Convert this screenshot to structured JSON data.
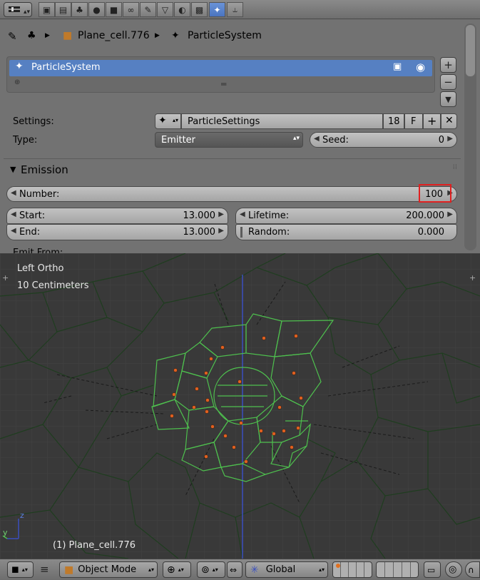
{
  "header": {
    "tabs": [
      "render",
      "render-layers",
      "scene",
      "world",
      "object",
      "constraints",
      "modifiers",
      "data",
      "material",
      "texture",
      "particles",
      "physics"
    ],
    "active": "particles"
  },
  "path": {
    "object": "Plane_cell.776",
    "item": "ParticleSystem"
  },
  "slots": {
    "selected": "ParticleSystem"
  },
  "settings": {
    "label": "Settings:",
    "name": "ParticleSettings",
    "users": "18",
    "fake": "F"
  },
  "type": {
    "label": "Type:",
    "value": "Emitter"
  },
  "seed": {
    "label": "Seed:",
    "value": "0"
  },
  "emission": {
    "title": "Emission",
    "number_label": "Number:",
    "number_value": "100",
    "start_label": "Start:",
    "start_value": "13.000",
    "end_label": "End:",
    "end_value": "13.000",
    "lifetime_label": "Lifetime:",
    "lifetime_value": "200.000",
    "random_label": "Random:",
    "random_value": "0.000",
    "emit_from": "Emit From:"
  },
  "viewport": {
    "view_name": "Left Ortho",
    "scale": "10 Centimeters",
    "object": "(1) Plane_cell.776",
    "axis_y": "y",
    "axis_z": "z"
  },
  "footer": {
    "mode": "Object Mode",
    "orientation": "Global"
  },
  "colors": {
    "accent": "#5680c2",
    "highlight": "#e02020",
    "particle": "#e06020",
    "edge": "#4ec04e"
  }
}
